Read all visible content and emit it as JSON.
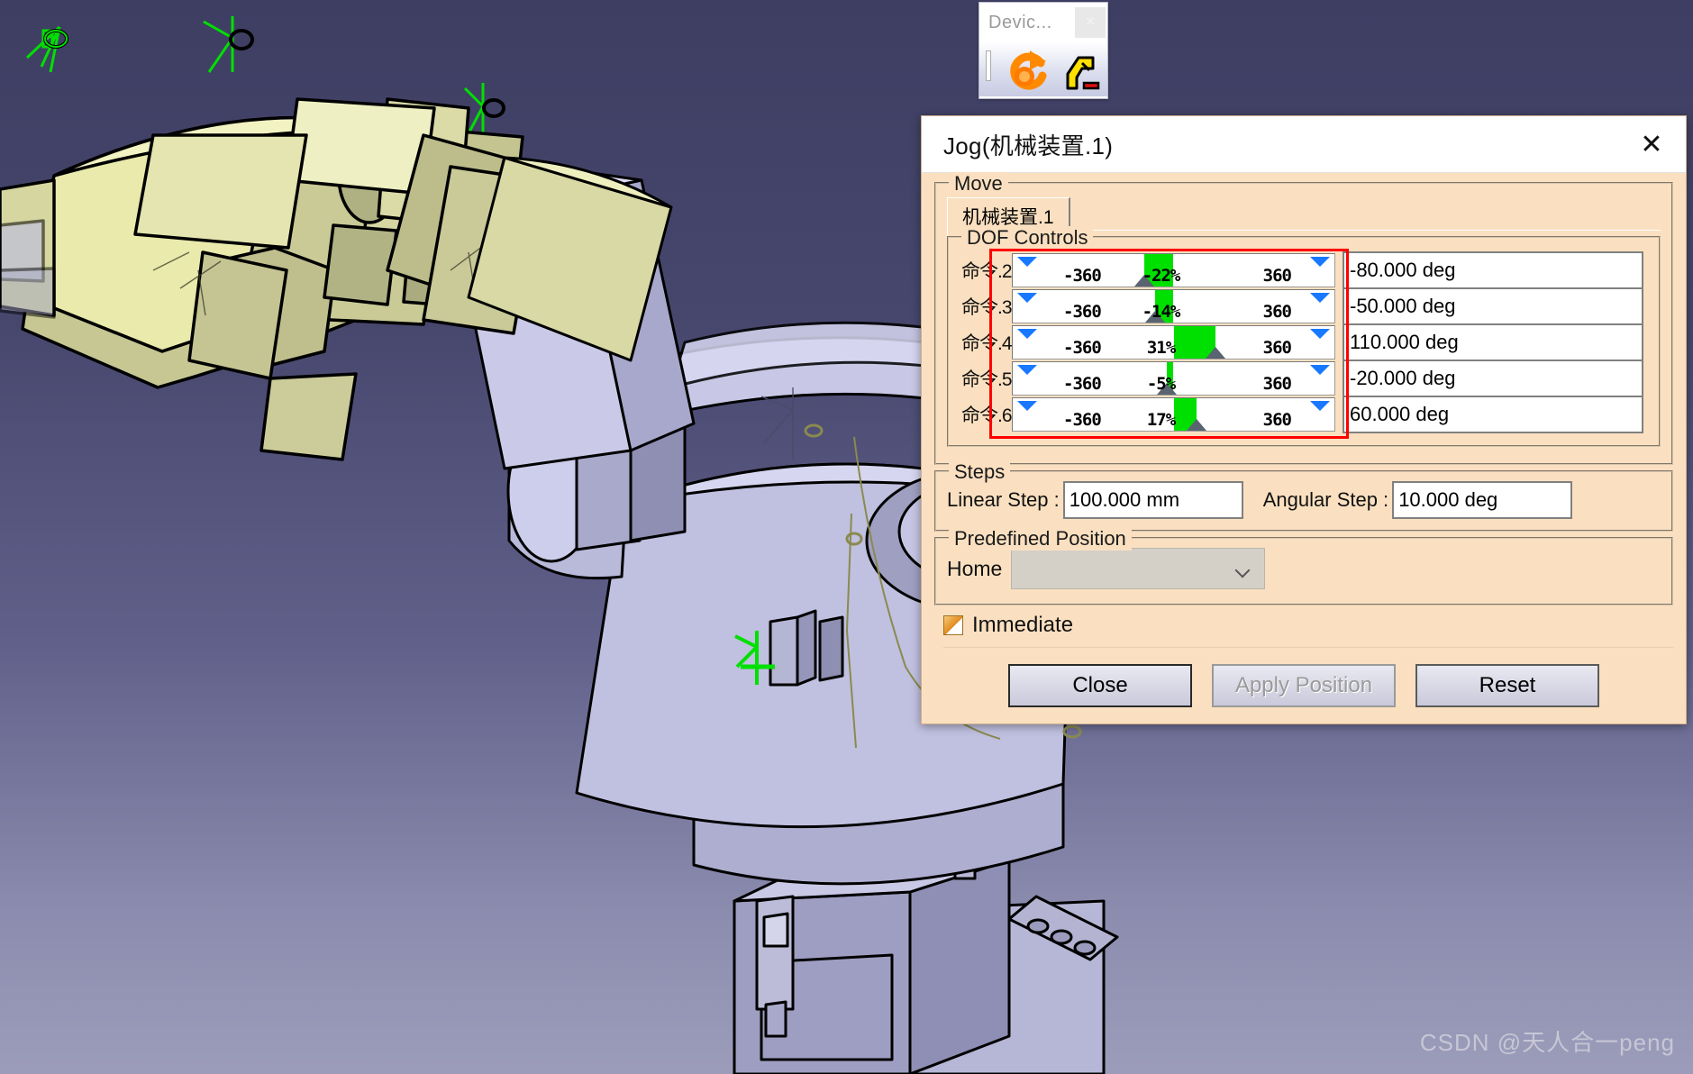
{
  "viewport": {
    "name": "catia-3d-viewport",
    "background_top": "#3e3e63",
    "background_bottom": "#9c9cba",
    "robot_upper_color": "#e8e9a8",
    "robot_mid_color": "#b8b98a",
    "robot_body_color": "#c3c3e0",
    "robot_shadow_color": "#9a9ab8",
    "axis_marker_color": "#00e000"
  },
  "device_toolbar": {
    "title": "Devic...",
    "close_label": "×",
    "icons": [
      "refresh-arrow-icon",
      "robot-device-icon"
    ]
  },
  "dialog": {
    "title": "Jog(机械装置.1)",
    "close_label": "✕",
    "move": {
      "legend": "Move",
      "tab_label": "机械装置.1"
    },
    "dof": {
      "legend": "DOF Controls",
      "min_label": "-360",
      "max_label": "360",
      "rows": [
        {
          "label": "命令.2",
          "percent_label": "-22%",
          "percent": -22,
          "value": "-80.000 deg"
        },
        {
          "label": "命令.3",
          "percent_label": "-14%",
          "percent": -14,
          "value": "-50.000 deg"
        },
        {
          "label": "命令.4",
          "percent_label": "31%",
          "percent": 31,
          "value": "110.000 deg"
        },
        {
          "label": "命令.5",
          "percent_label": "-5%",
          "percent": -5,
          "value": "-20.000 deg"
        },
        {
          "label": "命令.6",
          "percent_label": "17%",
          "percent": 17,
          "value": "60.000 deg"
        }
      ],
      "highlight_color": "#ff0000",
      "bar_color": "#00e000"
    },
    "steps": {
      "legend": "Steps",
      "linear_label": "Linear Step :",
      "linear_value": "100.000 mm",
      "angular_label": "Angular Step :",
      "angular_value": "10.000 deg"
    },
    "predefined": {
      "legend": "Predefined Position",
      "home_label": "Home",
      "home_value": ""
    },
    "immediate_label": "Immediate",
    "buttons": {
      "close": "Close",
      "apply": "Apply Position",
      "reset": "Reset"
    }
  },
  "watermark": "CSDN @天人合一peng"
}
